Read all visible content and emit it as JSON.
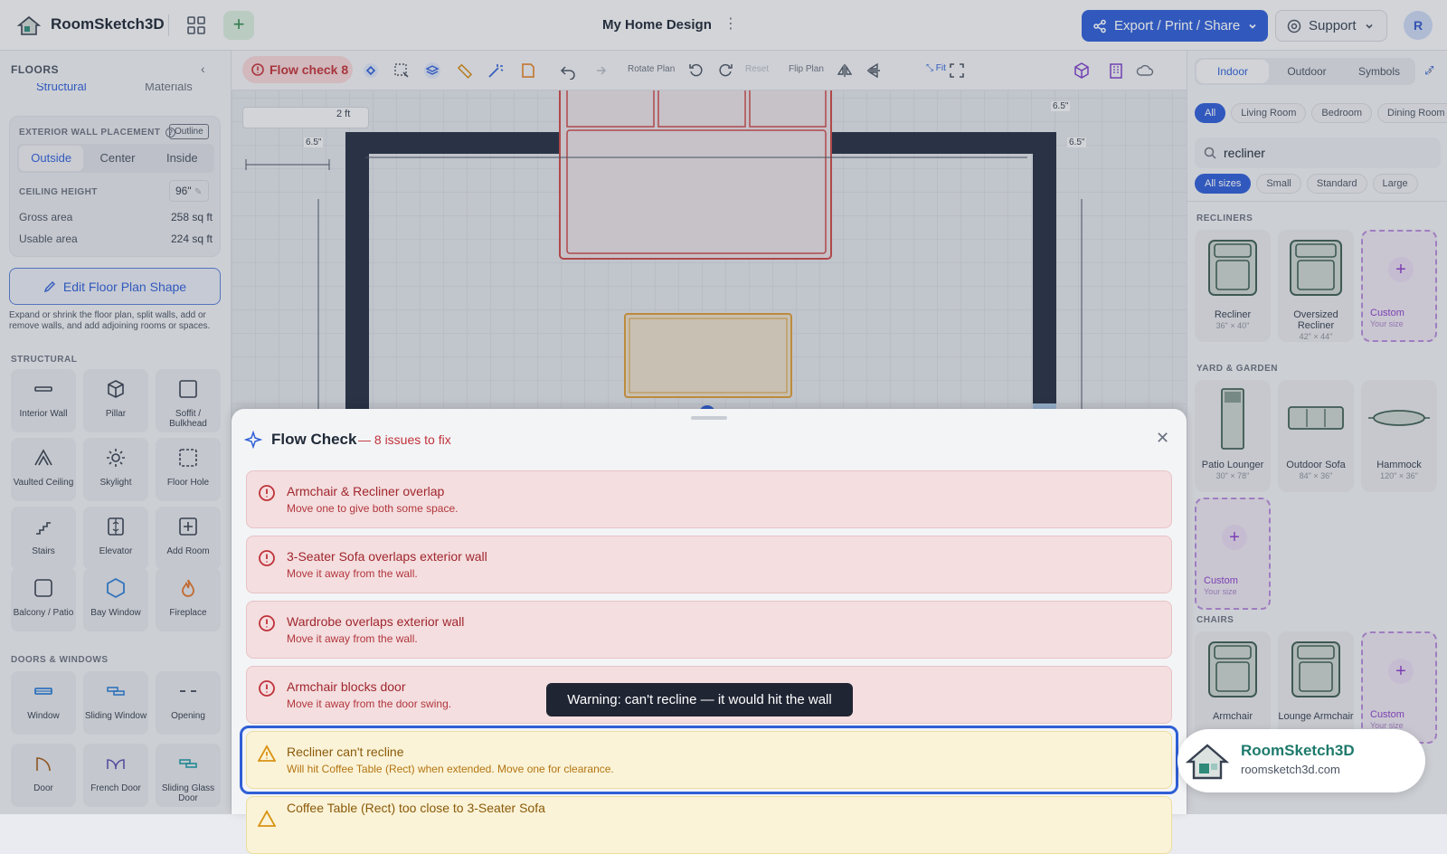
{
  "header": {
    "app_name": "RoomSketch3D",
    "document_title": "My Home Design",
    "export_label": "Export / Print / Share",
    "support_label": "Support",
    "avatar_initial": "R",
    "accent": "#2f5fd6"
  },
  "left_panel": {
    "title": "FLOORS",
    "segment_tabs": [
      "Structural",
      "Materials"
    ],
    "exterior_wall_placement_label": "EXTERIOR WALL PLACEMENT",
    "outline_label": "Outline",
    "placement_options": [
      "Outside",
      "Center",
      "Inside"
    ],
    "placement_selected": "Outside",
    "ceiling_height_label": "CEILING HEIGHT",
    "ceiling_height_value": "96\"",
    "gross_area_label": "Gross area",
    "gross_area_value": "258 sq ft",
    "usable_area_label": "Usable area",
    "usable_area_value": "224 sq ft",
    "edit_button_label": "Edit Floor Plan Shape",
    "edit_description": "Expand or shrink the floor plan, split walls, add or remove walls, and add adjoining rooms or spaces.",
    "structural_heading": "STRUCTURAL",
    "structural_items": [
      "Interior Wall",
      "Pillar",
      "Soffit / Bulkhead",
      "Vaulted Ceiling",
      "Skylight",
      "Floor Hole",
      "Stairs",
      "Elevator",
      "Add Room",
      "Balcony / Patio",
      "Bay Window",
      "Fireplace"
    ],
    "doors_heading": "DOORS & WINDOWS",
    "doors_items": [
      "Window",
      "Sliding Window",
      "Opening",
      "Door",
      "French Door",
      "Sliding Glass Door"
    ]
  },
  "toolbar": {
    "flow_check_label": "Flow check 8",
    "rotate_plan_label": "Rotate Plan",
    "reset_label": "Reset",
    "flip_plan_label": "Flip Plan",
    "fit_label": "Fit"
  },
  "plan": {
    "dim_2ft": "2 ft",
    "dim_a": "6.5\"",
    "dim_b": "6.5\"",
    "dim_c": "6.5\"",
    "dim_d": "6.5\""
  },
  "right_panel": {
    "tabs": [
      "Indoor",
      "Outdoor",
      "Symbols"
    ],
    "tab_selected": "Indoor",
    "room_chips": [
      "All",
      "Living Room",
      "Bedroom",
      "Dining Room"
    ],
    "search_value": "recliner",
    "size_chips": [
      "All sizes",
      "Small",
      "Standard",
      "Large"
    ],
    "recliners_heading": "RECLINERS",
    "recliners": [
      {
        "name": "Recliner",
        "size": "36\" × 40\""
      },
      {
        "name": "Oversized Recliner",
        "size": "42\" × 44\""
      }
    ],
    "custom_label": "Custom",
    "custom_size_label": "Your size",
    "yard_heading": "YARD & GARDEN",
    "yard_items": [
      {
        "name": "Patio Lounger",
        "size": "30\" × 78\""
      },
      {
        "name": "Outdoor Sofa",
        "size": "84\" × 36\""
      },
      {
        "name": "Hammock",
        "size": "120\" × 36\""
      }
    ],
    "chairs_heading": "CHAIRS",
    "chairs": [
      {
        "name": "Armchair",
        "size": ""
      },
      {
        "name": "Lounge Armchair",
        "size": ""
      }
    ]
  },
  "flow_check": {
    "title": "Flow Check",
    "subtitle": "— 8 issues to fix",
    "issues": [
      {
        "title": "Armchair & Recliner overlap",
        "desc": "Move one to give both some space.",
        "level": "error"
      },
      {
        "title": "3-Seater Sofa overlaps exterior wall",
        "desc": "Move it away from the wall.",
        "level": "error"
      },
      {
        "title": "Wardrobe overlaps exterior wall",
        "desc": "Move it away from the wall.",
        "level": "error"
      },
      {
        "title": "Armchair blocks door",
        "desc": "Move it away from the door swing.",
        "level": "error"
      },
      {
        "title": "Recliner can't recline",
        "desc": "Will hit Coffee Table (Rect) when extended. Move one for clearance.",
        "level": "warning"
      },
      {
        "title": "Coffee Table (Rect) too close to 3-Seater Sofa",
        "desc": "",
        "level": "warning"
      }
    ],
    "tooltip": "Warning: can't recline — it would hit the wall"
  },
  "badge": {
    "name": "RoomSketch3D",
    "url": "roomsketch3d.com"
  }
}
